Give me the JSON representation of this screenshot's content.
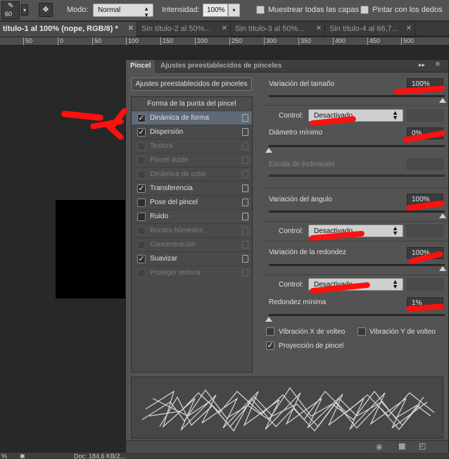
{
  "options_bar": {
    "brush_size": "60",
    "mode_label": "Modo:",
    "mode_value": "Normal",
    "intensity_label": "Intensidad:",
    "intensity_value": "100%",
    "sample_all_layers_label": "Muestrear todas las capas",
    "finger_paint_label": "Pintar con los dedos"
  },
  "document_tabs": [
    {
      "label": "título-1 al 100% (nope, RGB/8) *",
      "active": true
    },
    {
      "label": "Sin título-2 al 50%...",
      "active": false
    },
    {
      "label": "Sin título-3 al 50%...",
      "active": false
    },
    {
      "label": "Sin título-4 al 66,7...",
      "active": false
    }
  ],
  "ruler_ticks": [
    "50",
    "0",
    "50",
    "100",
    "150",
    "200",
    "250",
    "300",
    "350",
    "400",
    "450",
    "500"
  ],
  "panel": {
    "tabs": [
      "Pincel",
      "Ajustes preestablecidos de pinceles"
    ],
    "presets_button": "Ajustes preestablecidos de pinceles",
    "list_header": "Forma de la punta del pincel",
    "items": [
      {
        "label": "Dinámica de forma",
        "checked": true,
        "enabled": true,
        "selected": true
      },
      {
        "label": "Dispersión",
        "checked": true,
        "enabled": true,
        "selected": false
      },
      {
        "label": "Textura",
        "checked": false,
        "enabled": false,
        "selected": false
      },
      {
        "label": "Pincel doble",
        "checked": false,
        "enabled": false,
        "selected": false
      },
      {
        "label": "Dinámica de color",
        "checked": false,
        "enabled": false,
        "selected": false
      },
      {
        "label": "Transferencia",
        "checked": true,
        "enabled": true,
        "selected": false
      },
      {
        "label": "Pose del pincel",
        "checked": false,
        "enabled": true,
        "selected": false
      },
      {
        "label": "Ruido",
        "checked": false,
        "enabled": true,
        "selected": false
      },
      {
        "label": "Bordes húmedos",
        "checked": false,
        "enabled": false,
        "selected": false
      },
      {
        "label": "Concentración",
        "checked": false,
        "enabled": false,
        "selected": false
      },
      {
        "label": "Suavizar",
        "checked": true,
        "enabled": true,
        "selected": false
      },
      {
        "label": "Proteger textura",
        "checked": false,
        "enabled": false,
        "selected": false
      }
    ],
    "settings": {
      "size_jitter_label": "Variación del tamaño",
      "size_jitter_value": "100%",
      "control_label": "Control:",
      "control_value": "Desactivado",
      "min_diameter_label": "Diámetro mínimo",
      "min_diameter_value": "0%",
      "tilt_scale_label": "Escala de inclinación",
      "angle_jitter_label": "Variación del ángulo",
      "angle_jitter_value": "100%",
      "roundness_jitter_label": "Variación de la redondez",
      "roundness_jitter_value": "100%",
      "min_roundness_label": "Redondez mínima",
      "min_roundness_value": "1%",
      "flip_x_label": "Vibración X de volteo",
      "flip_y_label": "Vibración Y de volteo",
      "brush_projection_label": "Proyección de pincel"
    }
  },
  "status": {
    "zoom": "%",
    "doc": "Doc: 184,6 KB/2..."
  },
  "colors": {
    "annotation": "#ff1010",
    "selected_row": "#5f6a78"
  }
}
